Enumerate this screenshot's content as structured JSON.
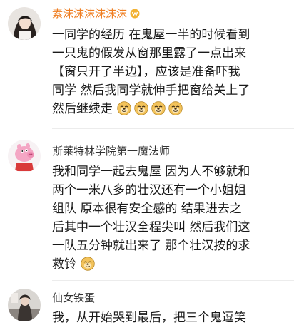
{
  "comments": [
    {
      "username": "素沫沫沫沫沫沫",
      "lines": [
        "一同学的经历 在鬼屋一半的时候看到",
        "一只鬼的假发从窗那里露了一点出来",
        "【窗只开了半边】，应该是准备吓我",
        "同学 然后我同学就伸手把窗给关上了",
        "然后继续走"
      ],
      "emoji_count": 4,
      "emoji_name": "doge-emoji"
    },
    {
      "username": "斯莱特林学院第一魔法师",
      "lines": [
        "我和同学一起去鬼屋 因为人不够就和",
        "两个一米八多的壮汉还有一个小姐姐",
        "组队 原本很有安全感的 结果进去之",
        "后其中一个壮汉全程尖叫 然后我们这",
        "一队五分钟就出来了 那个壮汉按的求",
        "救铃"
      ],
      "emoji_count": 1,
      "emoji_name": "doge-emoji"
    },
    {
      "username": "仙女铁蛋",
      "lines": [
        "我，从开始哭到最后，把三个鬼逗笑"
      ]
    }
  ]
}
